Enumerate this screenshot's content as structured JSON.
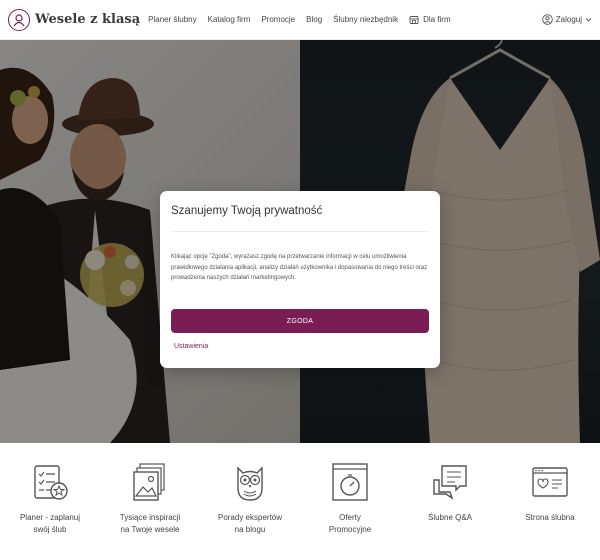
{
  "header": {
    "logo_text": "Wesele z klasą",
    "nav": [
      {
        "label": "Planer ślubny"
      },
      {
        "label": "Katalog firm"
      },
      {
        "label": "Promocje"
      },
      {
        "label": "Blog"
      },
      {
        "label": "Ślubny niezbędnik"
      },
      {
        "label": "Dla firm",
        "icon": "storefront-icon"
      }
    ],
    "login_label": "Zaloguj",
    "login_icon": "user-circle-icon"
  },
  "consent": {
    "title": "Szanujemy Twoją prywatność",
    "body": "Klikając opcję \"Zgoda\", wyrażasz zgodę na przetwarzanie informacji w celu umożliwienia prawidłowego działania aplikacji, analizy działań użytkownika i dopasowania do niego treści oraz prowadzenia naszych działań marketingowych.",
    "agree_label": "ZGODA",
    "settings_label": "Ustawienia"
  },
  "features": [
    {
      "label": "Planer - zaplanuj\nswój ślub",
      "icon": "planner-checklist-icon"
    },
    {
      "label": "Tysiące inspiracji\nna Twoje wesele",
      "icon": "photo-gallery-icon"
    },
    {
      "label": "Porady ekspertów\nna blogu",
      "icon": "owl-icon"
    },
    {
      "label": "Oferty\nPromocyjne",
      "icon": "promo-timer-icon"
    },
    {
      "label": "Ślubne Q&A",
      "icon": "chat-bubbles-icon"
    },
    {
      "label": "Strona ślubna",
      "icon": "wedding-website-icon"
    }
  ],
  "colors": {
    "brand": "#7a1d55",
    "text": "#333333",
    "overlay": "rgba(0,0,0,0.42)"
  }
}
